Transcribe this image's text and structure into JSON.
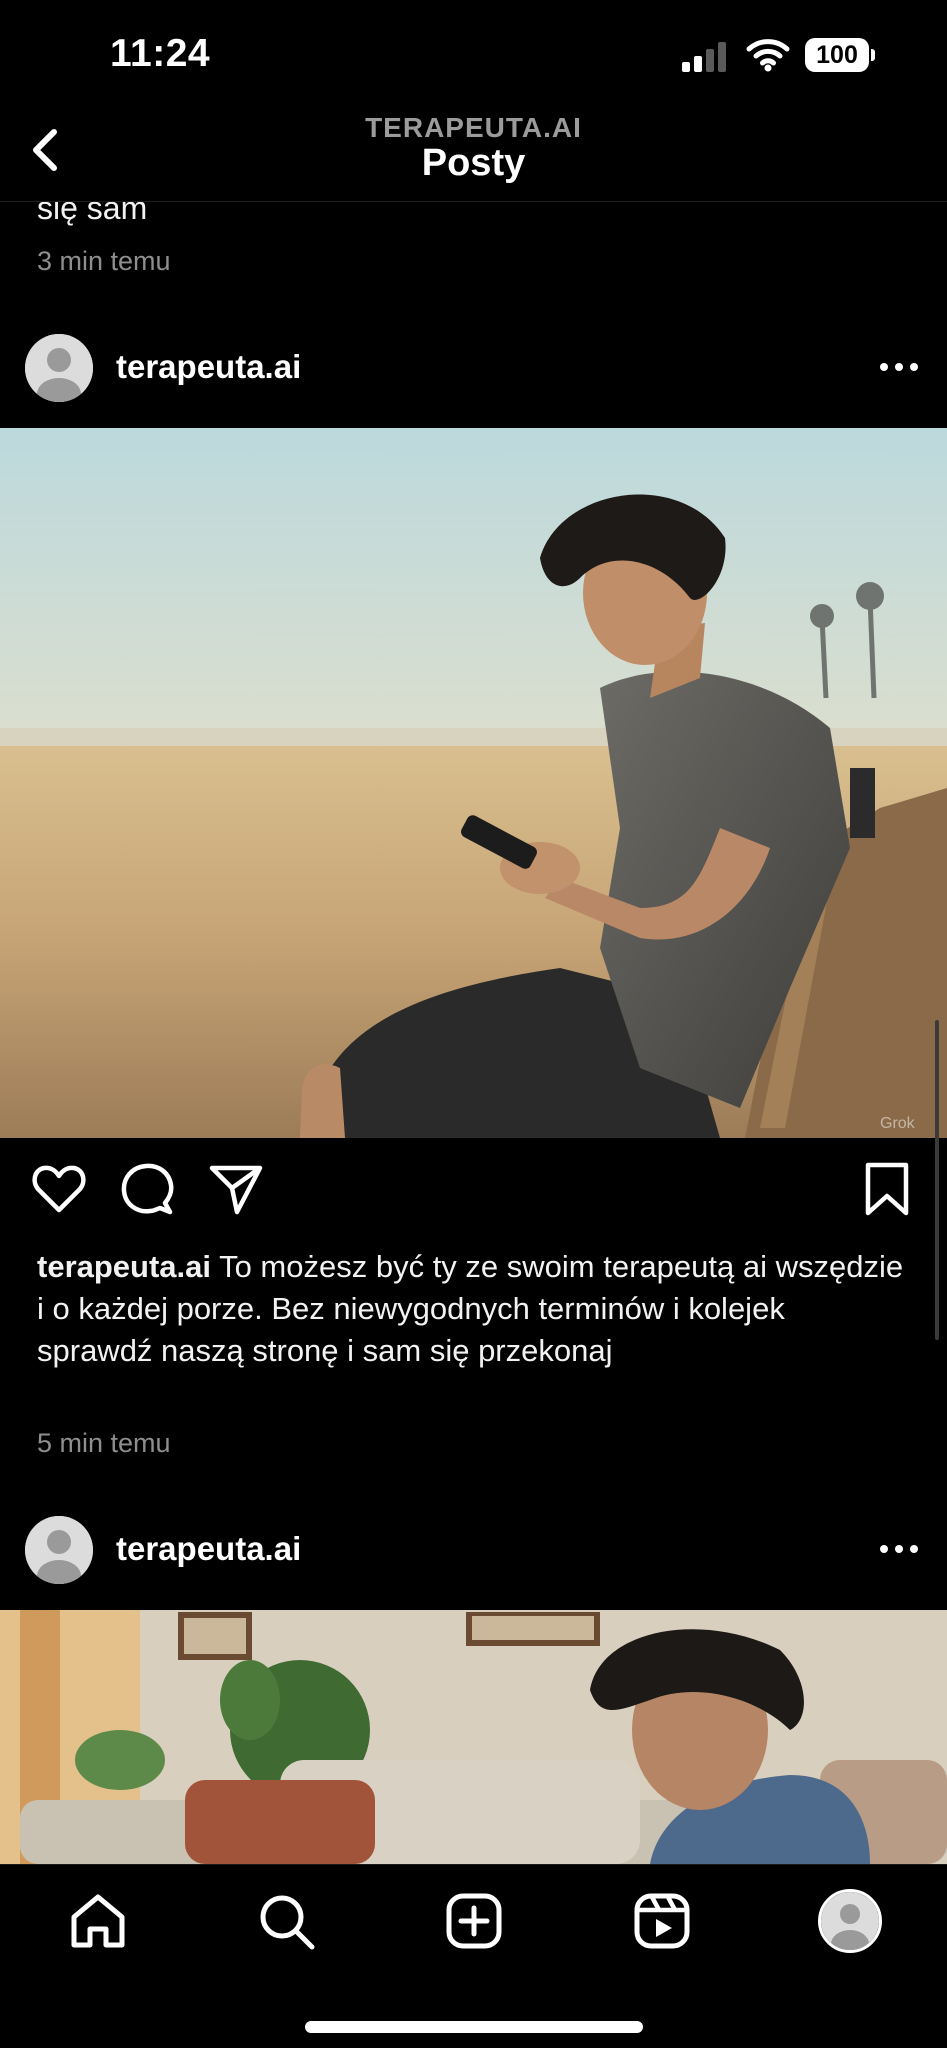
{
  "status_bar": {
    "time": "11:24",
    "battery": "100",
    "icons": [
      "signal-icon",
      "wifi-icon",
      "battery-icon"
    ]
  },
  "header": {
    "subtitle": "TERAPEUTA.AI",
    "title": "Posty",
    "back_icon": "chevron-left-icon"
  },
  "previous_post": {
    "caption_tail": "się sam",
    "time": "3 min temu"
  },
  "posts": [
    {
      "username": "terapeuta.ai",
      "image_description": "man on beach bench looking at phone",
      "caption_user": "terapeuta.ai",
      "caption_text": " To możesz być ty ze swoim terapeutą ai wszędzie i  o każdej porze. Bez niewygodnych terminów i kolejek sprawdź naszą stronę i sam się przekonaj",
      "time": "5 min temu",
      "actions": [
        "heart-icon",
        "comment-icon",
        "share-icon",
        "bookmark-icon"
      ]
    },
    {
      "username": "terapeuta.ai",
      "image_description": "man on sofa in living room looking down"
    }
  ],
  "bottom_nav": [
    "home-icon",
    "search-icon",
    "create-icon",
    "reels-icon",
    "profile-avatar"
  ],
  "colors": {
    "background": "#000000",
    "text": "#ffffff",
    "secondary_text": "#8e8e8e"
  }
}
